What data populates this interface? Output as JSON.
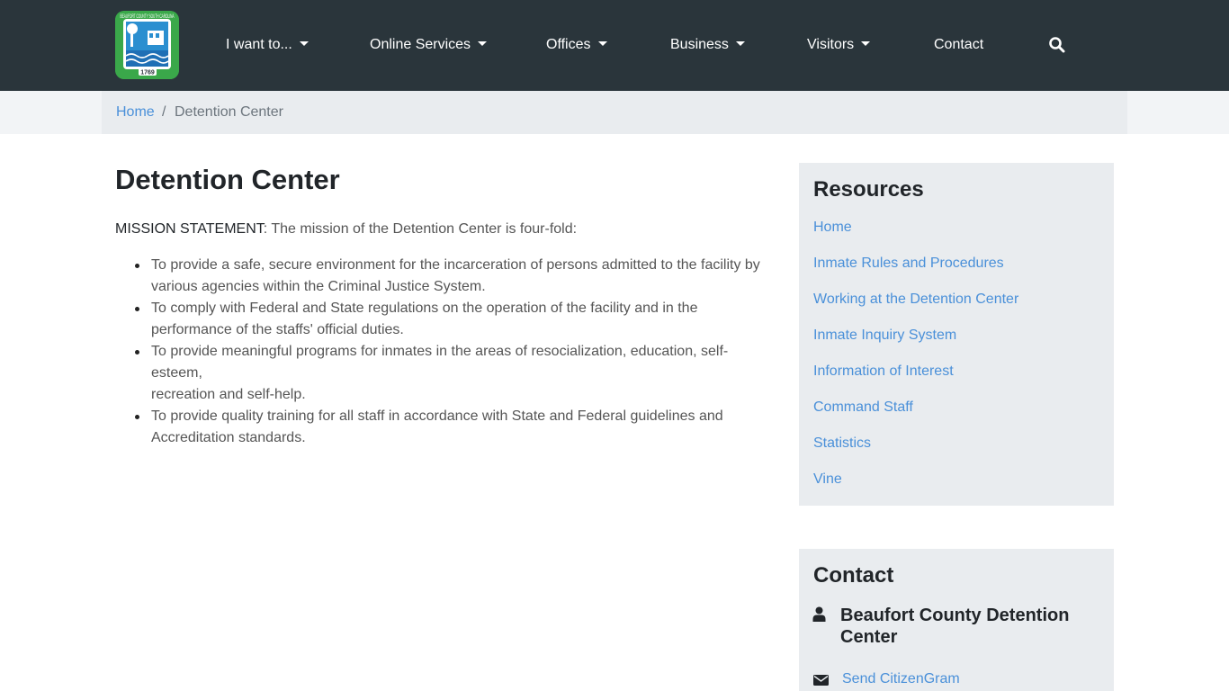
{
  "header": {
    "logo": {
      "text_top": "BEAUFORT COUNTY SOUTH CAROLINA",
      "year": "1769"
    },
    "nav": [
      {
        "label": "I want to...",
        "dropdown": true
      },
      {
        "label": "Online Services",
        "dropdown": true
      },
      {
        "label": "Offices",
        "dropdown": true
      },
      {
        "label": "Business",
        "dropdown": true
      },
      {
        "label": "Visitors",
        "dropdown": true
      },
      {
        "label": "Contact",
        "dropdown": false
      }
    ],
    "search_icon": "search-icon"
  },
  "breadcrumb": {
    "home": "Home",
    "separator": "/",
    "current": "Detention Center"
  },
  "main": {
    "title": "Detention Center",
    "mission_label": "MISSION STATEMENT",
    "mission_text": ": The mission of the Detention Center is four-fold:",
    "items": [
      {
        "line1": "To provide a safe, secure environment for the incarceration of persons admitted to the facility by",
        "line2": "various agencies within the Criminal Justice System."
      },
      {
        "line1": "To comply with Federal and State regulations on the operation of the facility and in the",
        "line2": "performance of the staffs' official duties."
      },
      {
        "line1": "To provide meaningful programs for inmates in the areas of resocialization, education, self-esteem,",
        "line2": "recreation and self-help."
      },
      {
        "line1": "To provide quality training for all staff in accordance with State and Federal guidelines and",
        "line2": "Accreditation standards."
      }
    ]
  },
  "sidebar": {
    "resources": {
      "title": "Resources",
      "links": [
        "Home",
        "Inmate Rules and Procedures",
        "Working at the Detention Center",
        "Inmate Inquiry System",
        "Information of Interest",
        "Command Staff",
        "Statistics",
        "Vine"
      ]
    },
    "contact": {
      "title": "Contact",
      "name": "Beaufort County Detention Center",
      "person_icon": "user-icon",
      "mail_icon": "envelope-icon",
      "citizengram": "Send CitizenGram"
    }
  },
  "colors": {
    "navbar": "#2a353b",
    "link": "#4a90d9",
    "panel": "#e9ecef",
    "logo_green": "#3aa84a"
  }
}
